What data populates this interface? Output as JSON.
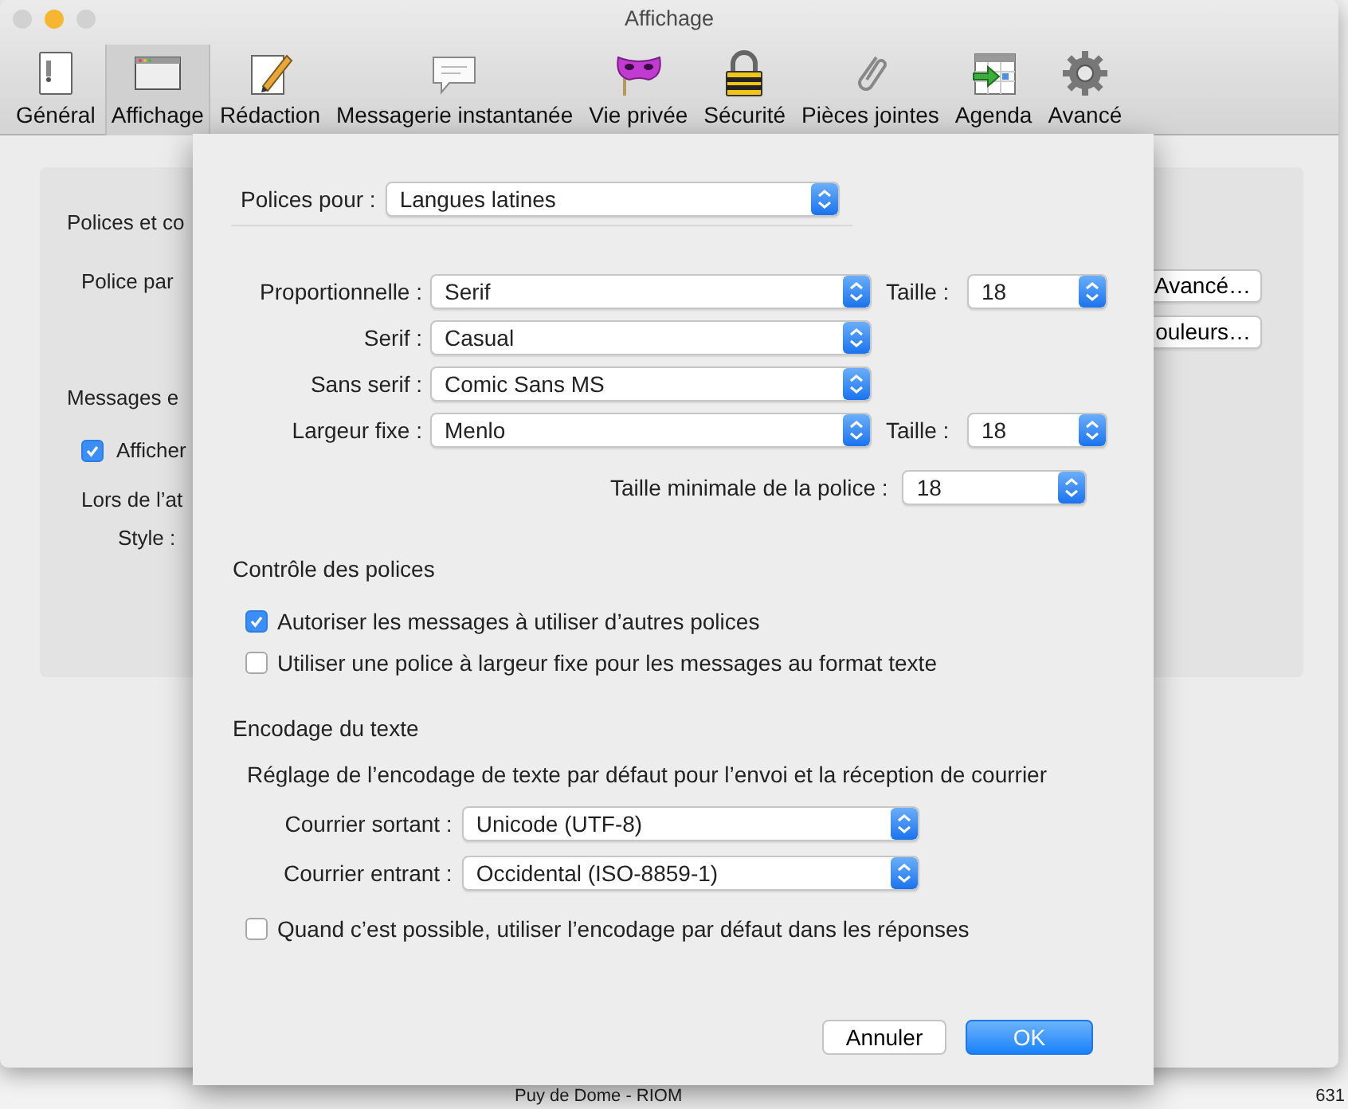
{
  "window": {
    "title": "Affichage",
    "lights": [
      {
        "color": "#d1d1d1"
      },
      {
        "color": "#f5b731"
      },
      {
        "color": "#d1d1d1"
      }
    ]
  },
  "toolbar": [
    {
      "label": "Général",
      "selected": false
    },
    {
      "label": "Affichage",
      "selected": true
    },
    {
      "label": "Rédaction",
      "selected": false
    },
    {
      "label": "Messagerie instantanée",
      "selected": false
    },
    {
      "label": "Vie privée",
      "selected": false
    },
    {
      "label": "Sécurité",
      "selected": false
    },
    {
      "label": "Pièces jointes",
      "selected": false
    },
    {
      "label": "Agenda",
      "selected": false
    },
    {
      "label": "Avancé",
      "selected": false
    }
  ],
  "background_panel": {
    "section_1": "Polices et co",
    "default_font": "Police par",
    "section_2": "Messages e",
    "checkbox": {
      "label": "Afficher",
      "checked": true
    },
    "on_label": "Lors de l’at",
    "style_label": "Style :",
    "buttons": [
      "Avancé…",
      "ouleurs…"
    ]
  },
  "sheet": {
    "fonts_for": {
      "label": "Polices pour :",
      "value": "Langues latines"
    },
    "font_rows": [
      {
        "label": "Proportionnelle :",
        "value": "Serif",
        "size_label": "Taille :",
        "size": "18"
      },
      {
        "label": "Serif :",
        "value": "Casual"
      },
      {
        "label": "Sans serif :",
        "value": "Comic Sans MS"
      },
      {
        "label": "Largeur fixe :",
        "value": "Menlo",
        "size_label": "Taille :",
        "size": "18"
      }
    ],
    "min_size": {
      "label": "Taille minimale de la police :",
      "value": "18"
    },
    "font_control": {
      "heading": "Contrôle des polices",
      "options": [
        {
          "label": "Autoriser les messages à utiliser d’autres polices",
          "checked": true
        },
        {
          "label": "Utiliser une police à largeur fixe pour les messages au format texte",
          "checked": false
        }
      ]
    },
    "encoding": {
      "heading": "Encodage du texte",
      "description": "Réglage de l’encodage de texte par défaut pour l’envoi et la réception de courrier",
      "rows": [
        {
          "label": "Courrier sortant :",
          "value": "Unicode (UTF-8)"
        },
        {
          "label": "Courrier entrant :",
          "value": "Occidental (ISO-8859-1)"
        }
      ],
      "option": {
        "label": "Quand c’est possible, utiliser l’encodage par défaut dans les réponses",
        "checked": false
      }
    },
    "buttons": [
      {
        "label": "Annuler",
        "kind": "secondary"
      },
      {
        "label": "OK",
        "kind": "default"
      }
    ]
  },
  "behind": {
    "texts": [
      "Puy de Dome - RIOM",
      "631"
    ]
  }
}
